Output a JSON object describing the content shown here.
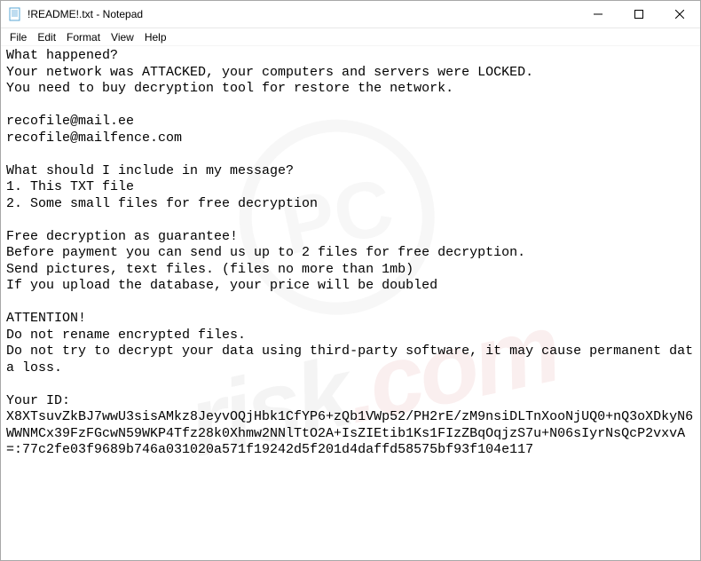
{
  "window": {
    "title": "!README!.txt - Notepad"
  },
  "menu": {
    "file": "File",
    "edit": "Edit",
    "format": "Format",
    "view": "View",
    "help": "Help"
  },
  "content": {
    "text": "What happened?\nYour network was ATTACKED, your computers and servers were LOCKED.\nYou need to buy decryption tool for restore the network.\n\nrecofile@mail.ee\nrecofile@mailfence.com\n\nWhat should I include in my message?\n1. This TXT file\n2. Some small files for free decryption\n\nFree decryption as guarantee!\nBefore payment you can send us up to 2 files for free decryption.\nSend pictures, text files. (files no more than 1mb)\nIf you upload the database, your price will be doubled\n\nATTENTION!\nDo not rename encrypted files.\nDo not try to decrypt your data using third-party software, it may cause permanent data loss.\n\nYour ID:\nX8XTsuvZkBJ7wwU3sisAMkz8JeyvOQjHbk1CfYP6+zQb1VWp52/PH2rE/zM9nsiDLTnXooNjUQ0+nQ3oXDkyN6WWNMCx39FzFGcwN59WKP4Tfz28k0Xhmw2NNlTtO2A+IsZIEtib1Ks1FIzZBqOqjzS7u+N06sIyrNsQcP2vxvA=:77c2fe03f9689b746a031020a571f19242d5f201d4daffd58575bf93f104e117"
  },
  "watermark": {
    "badge": "PC",
    "text_dark": "risk",
    "text_red": ".com"
  }
}
